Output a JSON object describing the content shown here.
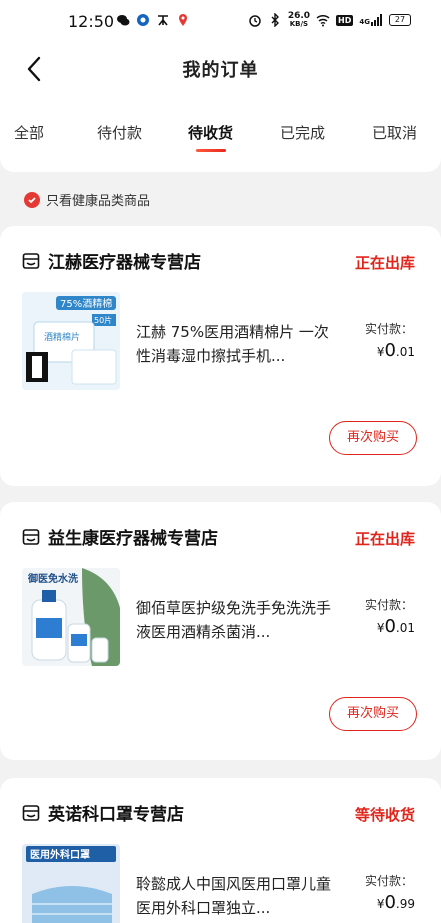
{
  "status_bar": {
    "time": "12:50",
    "network_speed": "26.0",
    "network_unit": "KB/S",
    "hd_label": "HD",
    "signal_label": "4G",
    "battery": "27"
  },
  "header": {
    "title": "我的订单"
  },
  "tabs": [
    {
      "label": "全部",
      "active": false
    },
    {
      "label": "待付款",
      "active": false
    },
    {
      "label": "待收货",
      "active": true
    },
    {
      "label": "已完成",
      "active": false
    },
    {
      "label": "已取消",
      "active": false
    }
  ],
  "filter": {
    "label": "只看健康品类商品",
    "checked": true
  },
  "orders": [
    {
      "shop_name": "江赫医疗器械专营店",
      "status": "正在出库",
      "product_title": "江赫 75%医用酒精棉片 一次性消毒湿巾擦拭手机...",
      "paid_label": "实付款：",
      "price_currency": "¥",
      "price_int": "0",
      "price_dec": ".01",
      "button_label": "再次购买",
      "thumb_text_1": "75%酒精棉",
      "thumb_text_2": "50片",
      "thumb_text_3": "酒精棉片"
    },
    {
      "shop_name": "益生康医疗器械专营店",
      "status": "正在出库",
      "product_title": "御佰草医护级免洗手免洗洗手液医用酒精杀菌消...",
      "paid_label": "实付款：",
      "price_currency": "¥",
      "price_int": "0",
      "price_dec": ".01",
      "button_label": "再次购买",
      "thumb_text_1": "御医免水洗"
    },
    {
      "shop_name": "英诺科口罩专营店",
      "status": "等待收货",
      "product_title": "聆懿成人中国风医用口罩儿童医用外科口罩独立...",
      "paid_label": "实付款：",
      "price_currency": "¥",
      "price_int": "0",
      "price_dec": ".99",
      "thumb_text_1": "医用外科口罩"
    }
  ],
  "colors": {
    "accent": "#e0261c",
    "background": "#f2f2f2"
  }
}
